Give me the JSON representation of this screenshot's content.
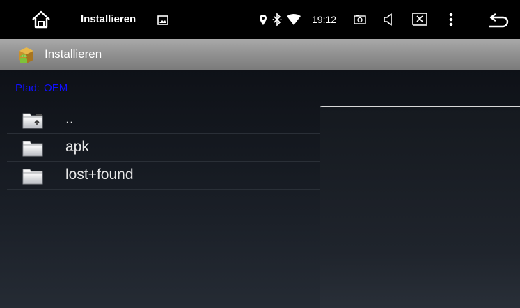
{
  "statusbar": {
    "title": "Installieren",
    "time": "19:12",
    "icons": [
      "home-icon",
      "picture-icon",
      "location-icon",
      "bluetooth-icon",
      "wifi-icon",
      "camera-icon",
      "volume-icon",
      "close-window-icon",
      "more-vert-icon",
      "back-icon"
    ]
  },
  "appbar": {
    "icon": "android-package-icon",
    "title": "Installieren"
  },
  "path": {
    "label": "Pfad:",
    "value": "OEM"
  },
  "files": [
    {
      "name": "..",
      "icon": "folder-up-icon"
    },
    {
      "name": "apk",
      "icon": "folder-icon"
    },
    {
      "name": "lost+found",
      "icon": "folder-icon"
    }
  ],
  "colors": {
    "path_text": "#1010ff",
    "appbar": "#9a9a9a",
    "background": "#000000"
  }
}
